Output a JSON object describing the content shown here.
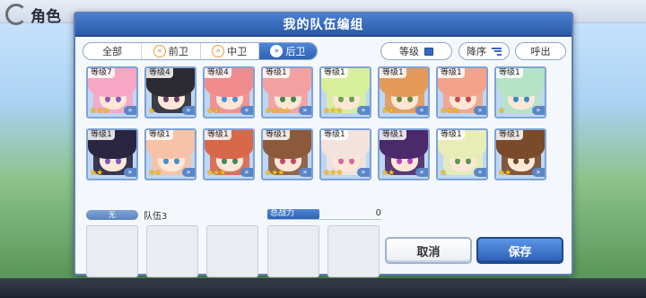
{
  "background": {
    "screen_title": "角色"
  },
  "dialog": {
    "title": "我的队伍编组"
  },
  "filters": {
    "tabs": [
      {
        "label": "全部",
        "icon": "",
        "active": false
      },
      {
        "label": "前卫",
        "icon": "position-front-icon",
        "active": false
      },
      {
        "label": "中卫",
        "icon": "position-middle-icon",
        "active": false
      },
      {
        "label": "后卫",
        "icon": "position-back-icon",
        "active": true
      }
    ],
    "sort_key": "等级",
    "sort_order": "降序",
    "call_label": "呼出"
  },
  "characters": [
    {
      "level": "等级7",
      "stars": "★★★",
      "hair": "#f7a6c4",
      "eyes": "#8a5ab6"
    },
    {
      "level": "等级4",
      "stars": "★",
      "hair": "#2c2b33",
      "eyes": "#6a3b6a"
    },
    {
      "level": "等级4",
      "stars": "★★",
      "hair": "#f08c8c",
      "eyes": "#4b8fcf"
    },
    {
      "level": "等级1",
      "stars": "★★★★",
      "hair": "#f5a0a0",
      "eyes": "#3d8a4a"
    },
    {
      "level": "等级1",
      "stars": "★★★",
      "hair": "#d8ef9a",
      "eyes": "#6aa14a"
    },
    {
      "level": "等级1",
      "stars": "★★",
      "hair": "#e59a5a",
      "eyes": "#6a8a3a"
    },
    {
      "level": "等级1",
      "stars": "★★★",
      "hair": "#f4a38a",
      "eyes": "#c04a4a"
    },
    {
      "level": "等级1",
      "stars": "★",
      "hair": "#b6e3c6",
      "eyes": "#3a8ac0"
    },
    {
      "level": "等级1",
      "stars": "★★",
      "hair": "#2a2540",
      "eyes": "#7a5ab6"
    },
    {
      "level": "等级1",
      "stars": "★★",
      "hair": "#f7c2a6",
      "eyes": "#4a90c0"
    },
    {
      "level": "等级1",
      "stars": "★★★",
      "hair": "#d8684a",
      "eyes": "#3a8a5a"
    },
    {
      "level": "等级1",
      "stars": "★★★",
      "hair": "#8c5a3a",
      "eyes": "#c04a6a"
    },
    {
      "level": "等级1",
      "stars": "★★★",
      "hair": "#f3e3dc",
      "eyes": "#d06aa0"
    },
    {
      "level": "等级1",
      "stars": "★★",
      "hair": "#4a2a6a",
      "eyes": "#b04ac0"
    },
    {
      "level": "等级1",
      "stars": "★",
      "hair": "#e8ecb6",
      "eyes": "#5a9a4a"
    },
    {
      "level": "等级1",
      "stars": "★★",
      "hair": "#7a4a2a",
      "eyes": "#6a4a2a"
    }
  ],
  "team": {
    "tag": "无",
    "name": "队伍3",
    "power_label": "总战力",
    "power_value": "0"
  },
  "actions": {
    "cancel": "取消",
    "save": "保存"
  }
}
